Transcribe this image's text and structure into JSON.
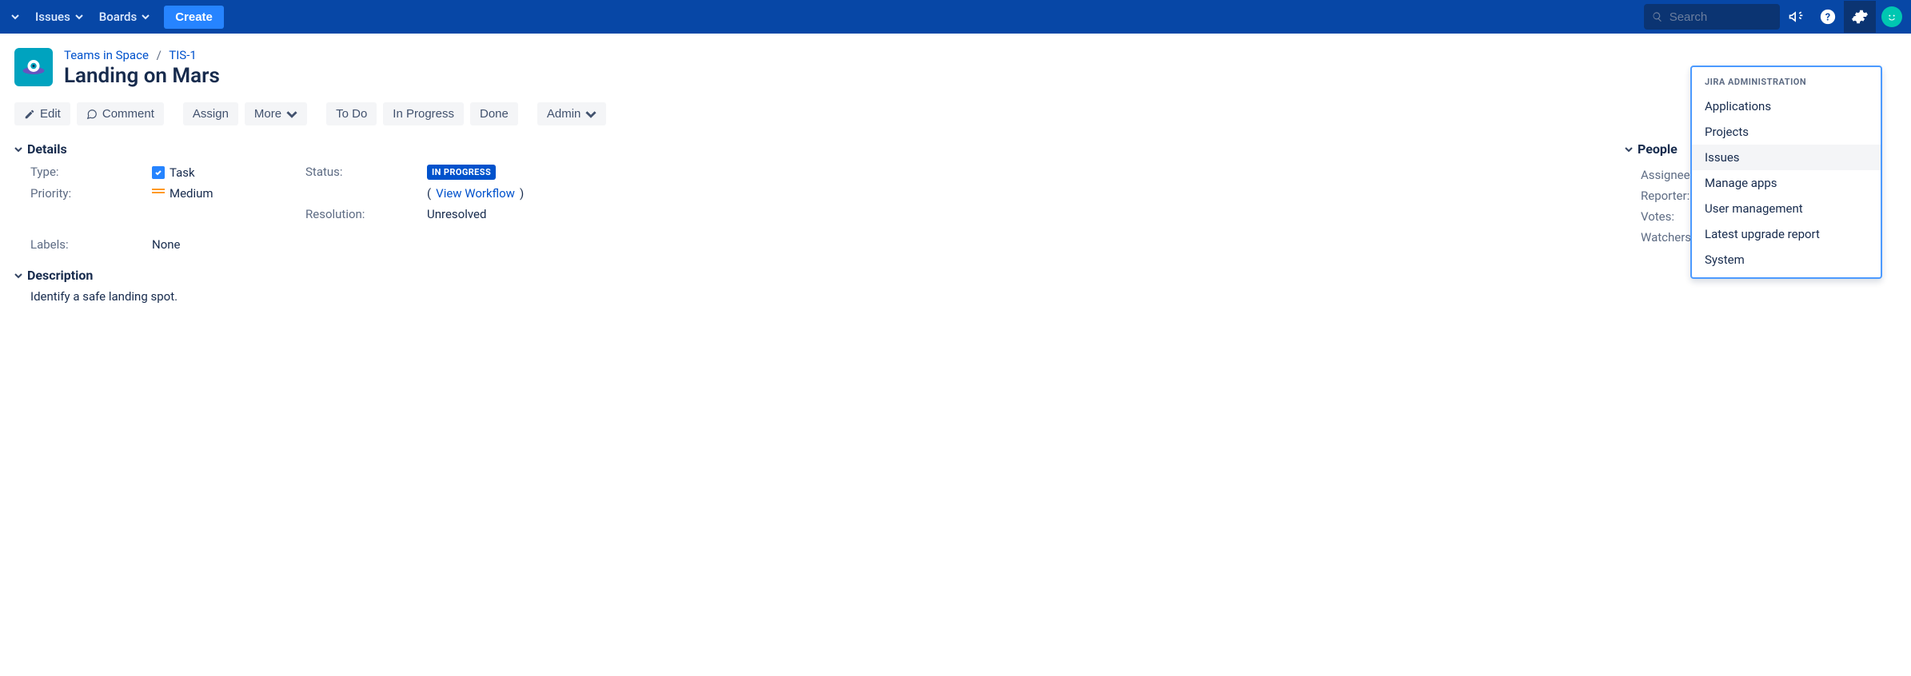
{
  "nav": {
    "issues": "Issues",
    "boards": "Boards",
    "create": "Create",
    "search_placeholder": "Search"
  },
  "breadcrumb": {
    "project": "Teams in Space",
    "key": "TIS-1"
  },
  "issue": {
    "title": "Landing on Mars"
  },
  "toolbar": {
    "edit": "Edit",
    "comment": "Comment",
    "assign": "Assign",
    "more": "More",
    "todo": "To Do",
    "in_progress": "In Progress",
    "done": "Done",
    "admin": "Admin"
  },
  "panels": {
    "details": "Details",
    "people": "People",
    "description": "Description"
  },
  "details": {
    "type_label": "Type:",
    "type_value": "Task",
    "priority_label": "Priority:",
    "priority_value": "Medium",
    "labels_label": "Labels:",
    "labels_value": "None",
    "status_label": "Status:",
    "status_value": "IN PROGRESS",
    "view_workflow": "View Workflow",
    "resolution_label": "Resolution:",
    "resolution_value": "Unresolved"
  },
  "people": {
    "assignee": "Assignee:",
    "reporter": "Reporter:",
    "votes": "Votes:",
    "watchers": "Watchers:"
  },
  "description": {
    "text": "Identify a safe landing spot."
  },
  "dropdown": {
    "heading": "JIRA ADMINISTRATION",
    "items": [
      "Applications",
      "Projects",
      "Issues",
      "Manage apps",
      "User management",
      "Latest upgrade report",
      "System"
    ],
    "hover_index": 2
  }
}
